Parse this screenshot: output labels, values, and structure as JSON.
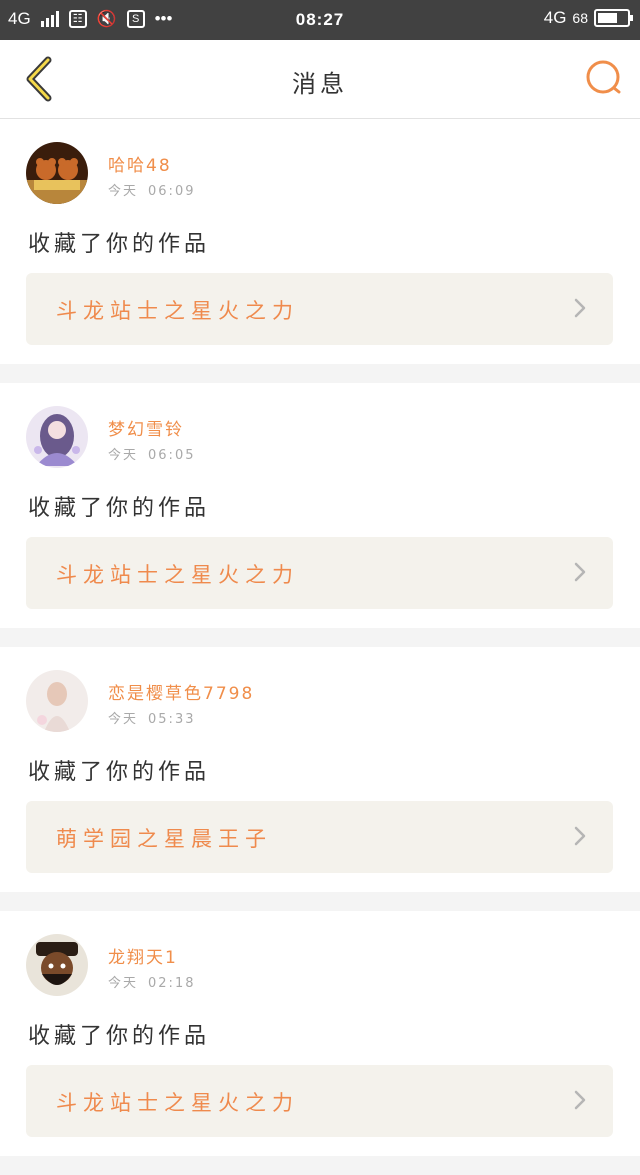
{
  "status_bar": {
    "network_left": "4G",
    "time": "08:27",
    "network_right": "4G",
    "battery_percent": "68",
    "battery_level": 0.68
  },
  "header": {
    "title": "消息",
    "back_icon": "chevron-left-icon",
    "search_icon": "search-icon",
    "accent_color": "#f08e4a"
  },
  "messages": [
    {
      "username": "哈哈48",
      "day": "今天",
      "time": "06:09",
      "action": "收藏了你的作品",
      "work_title": "斗龙站士之星火之力",
      "avatar": "bears-avatar"
    },
    {
      "username": "梦幻雪铃",
      "day": "今天",
      "time": "06:05",
      "action": "收藏了你的作品",
      "work_title": "斗龙站士之星火之力",
      "avatar": "anime-girl-avatar"
    },
    {
      "username": "恋是樱草色7798",
      "day": "今天",
      "time": "05:33",
      "action": "收藏了你的作品",
      "work_title": "萌学园之星晨王子",
      "avatar": "girl-photo-avatar"
    },
    {
      "username": "龙翔天1",
      "day": "今天",
      "time": "02:18",
      "action": "收藏了你的作品",
      "work_title": "斗龙站士之星火之力",
      "avatar": "warrior-avatar"
    }
  ]
}
